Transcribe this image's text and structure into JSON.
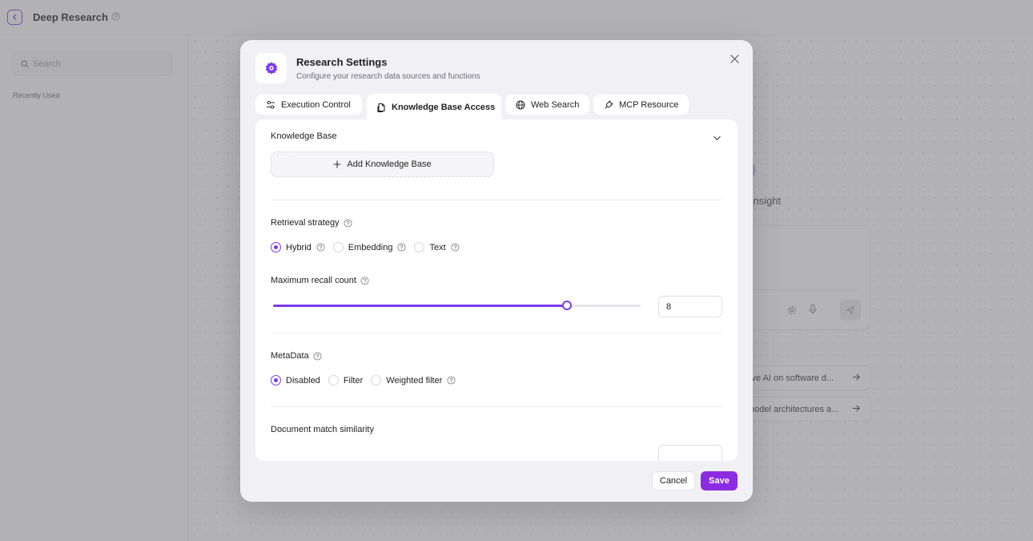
{
  "app": {
    "title": "Deep Research",
    "search_placeholder": "Search",
    "recently_used": "Recently Used",
    "insight_fragment": "o Insight",
    "suggestions": [
      "tive AI on software d...",
      "model architectures a..."
    ]
  },
  "modal": {
    "title": "Research Settings",
    "subtitle": "Configure your research data sources and functions",
    "tabs": [
      {
        "label": "Execution Control",
        "icon": "sliders-icon",
        "active": false
      },
      {
        "label": "Knowledge Base Access",
        "icon": "document-icon",
        "active": true
      },
      {
        "label": "Web Search",
        "icon": "globe-icon",
        "active": false
      },
      {
        "label": "MCP Resource",
        "icon": "plug-icon",
        "active": false
      }
    ],
    "knowledge_base": {
      "label": "Knowledge Base",
      "add_button": "Add Knowledge Base"
    },
    "retrieval_strategy": {
      "label": "Retrieval strategy",
      "options": [
        "Hybrid",
        "Embedding",
        "Text"
      ],
      "selected": "Hybrid"
    },
    "max_recall": {
      "label": "Maximum recall count",
      "value": "8",
      "slider_fraction": 0.8
    },
    "metadata": {
      "label": "MetaData",
      "options": [
        "Disabled",
        "Filter",
        "Weighted filter"
      ],
      "selected": "Disabled"
    },
    "doc_similarity": {
      "label": "Document match similarity"
    },
    "cancel_label": "Cancel",
    "save_label": "Save"
  },
  "colors": {
    "accent": "#7c3aed",
    "save_button": "#8b2be2"
  }
}
